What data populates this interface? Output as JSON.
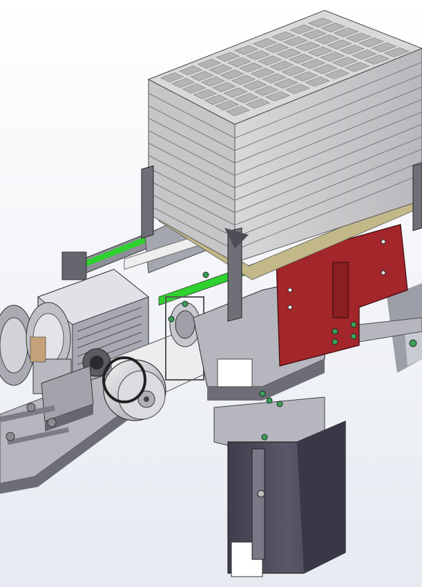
{
  "colors": {
    "background_top": "#ffffff",
    "background_bottom": "#e9edf3",
    "frame_steel": "#8a8c96",
    "frame_light": "#c9cad2",
    "frame_dark": "#55535f",
    "column": "#4d4a5a",
    "tray_stack": "#c8c8ca",
    "tray_grid": "#d9d9d9",
    "tray_cell": "#b4b4b4",
    "tray_base": "#c2b888",
    "belt_green": "#2fd12f",
    "bracket_red": "#a3262a",
    "motor_grey": "#b8b8bc",
    "bolt_green": "#3aa05a"
  },
  "parts": {
    "tray_stack": "stacked-tray-magazine",
    "conveyor": "green-belt-conveyor",
    "motor": "gear-motor",
    "pulley": "drive-pulley",
    "column": "support-column",
    "bracket": "red-lift-bracket"
  }
}
